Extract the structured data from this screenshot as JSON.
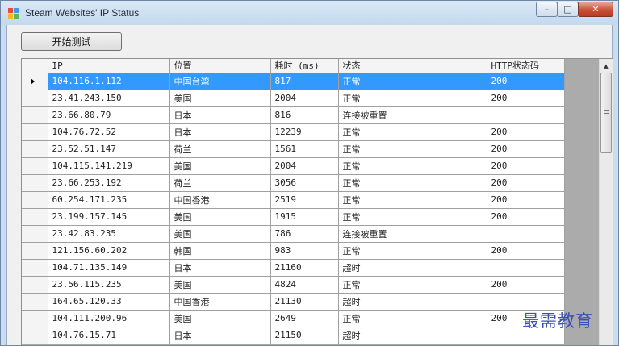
{
  "window": {
    "title": "Steam Websites' IP Status",
    "buttons": {
      "minimize": "–",
      "maximize": "□",
      "close": "✕"
    }
  },
  "toolbar": {
    "start_label": "开始测试"
  },
  "grid": {
    "columns": [
      "IP",
      "位置",
      "耗时 (ms)",
      "状态",
      "HTTP状态码"
    ],
    "selected_row": 0,
    "rows": [
      [
        "104.116.1.112",
        "中国台湾",
        "817",
        "正常",
        "200"
      ],
      [
        "23.41.243.150",
        "美国",
        "2004",
        "正常",
        "200"
      ],
      [
        "23.66.80.79",
        "日本",
        "816",
        "连接被重置",
        ""
      ],
      [
        "104.76.72.52",
        "日本",
        "12239",
        "正常",
        "200"
      ],
      [
        "23.52.51.147",
        "荷兰",
        "1561",
        "正常",
        "200"
      ],
      [
        "104.115.141.219",
        "美国",
        "2004",
        "正常",
        "200"
      ],
      [
        "23.66.253.192",
        "荷兰",
        "3056",
        "正常",
        "200"
      ],
      [
        "60.254.171.235",
        "中国香港",
        "2519",
        "正常",
        "200"
      ],
      [
        "23.199.157.145",
        "美国",
        "1915",
        "正常",
        "200"
      ],
      [
        "23.42.83.235",
        "美国",
        "786",
        "连接被重置",
        ""
      ],
      [
        "121.156.60.202",
        "韩国",
        "983",
        "正常",
        "200"
      ],
      [
        "104.71.135.149",
        "日本",
        "21160",
        "超时",
        ""
      ],
      [
        "23.56.115.235",
        "美国",
        "4824",
        "正常",
        "200"
      ],
      [
        "164.65.120.33",
        "中国香港",
        "21130",
        "超时",
        ""
      ],
      [
        "104.111.200.96",
        "美国",
        "2649",
        "正常",
        "200"
      ],
      [
        "104.76.15.71",
        "日本",
        "21150",
        "超时",
        ""
      ]
    ]
  },
  "watermark": "最需教育",
  "colors": {
    "selection": "#3399ff",
    "title_gradient": "#c4d8ee",
    "close_button": "#c7513a"
  }
}
